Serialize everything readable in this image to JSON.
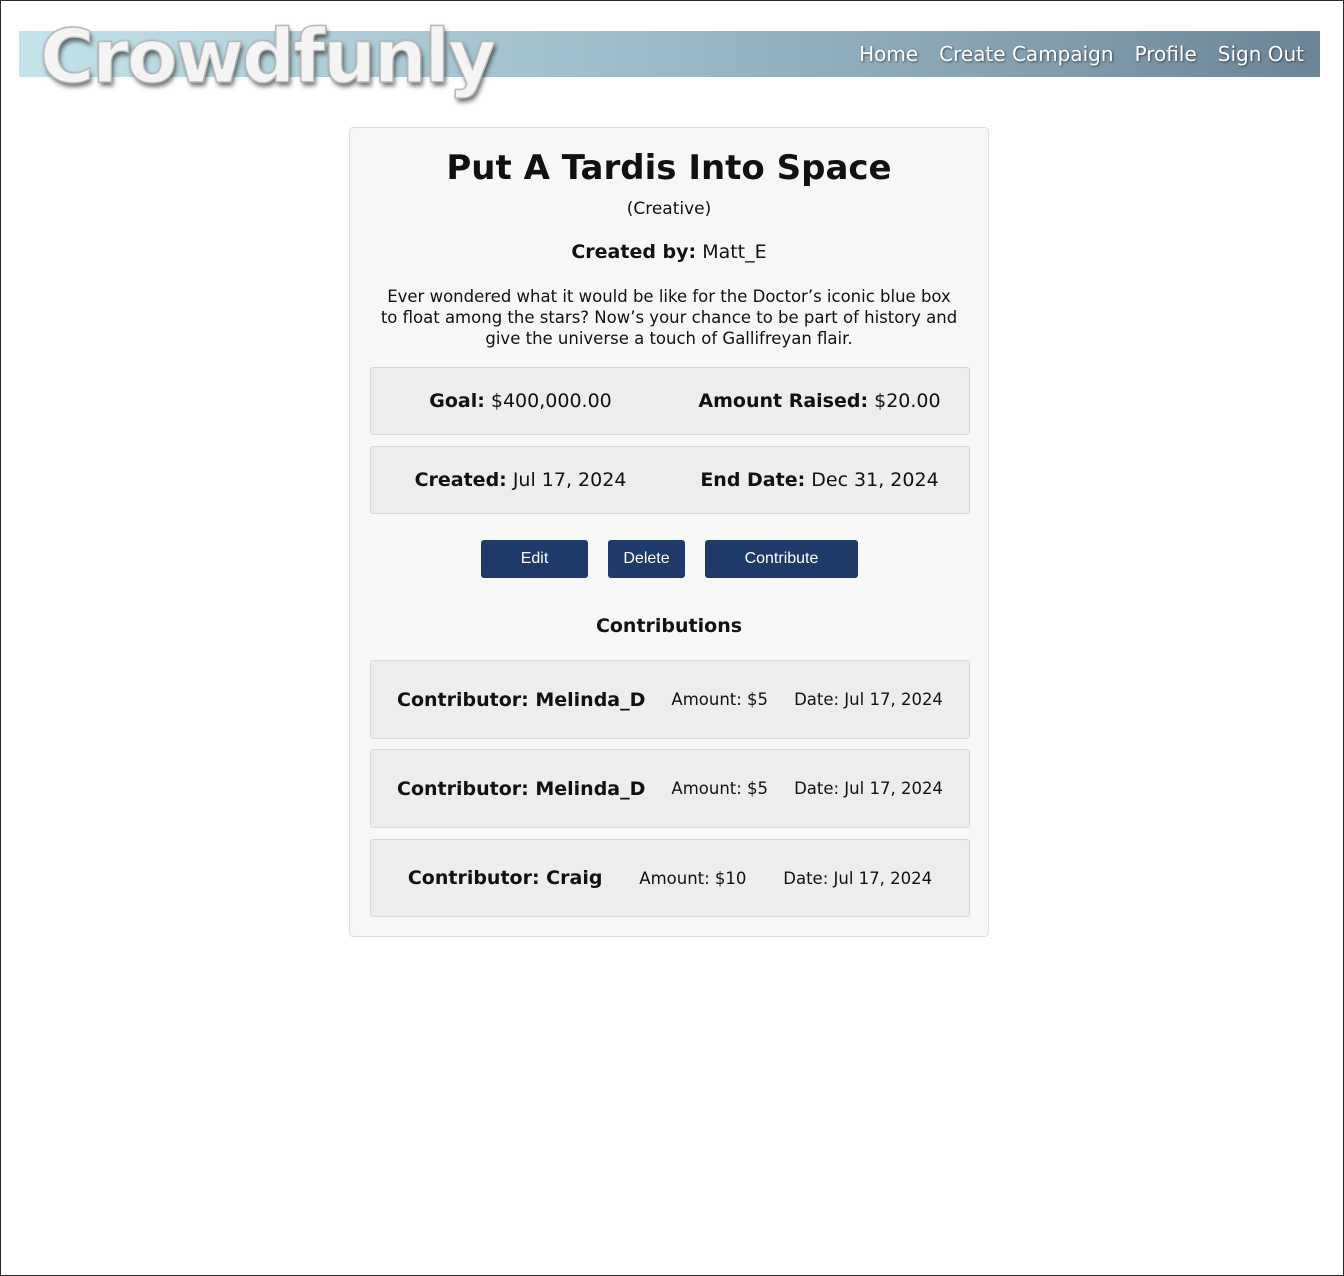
{
  "header": {
    "logo": "Crowdfunly",
    "nav": [
      "Home",
      "Create Campaign",
      "Profile",
      "Sign Out"
    ],
    "gradient_colors": [
      "#c3e3ea",
      "#6b8598"
    ]
  },
  "campaign": {
    "title": "Put A Tardis Into Space",
    "category": "(Creative)",
    "created_by_label": "Created by:",
    "creator": "Matt_E",
    "description": "Ever wondered what it would be like for the Doctor’s iconic blue box to float among the stars? Now’s your chance to be part of history and give the universe a touch of Gallifreyan flair.",
    "goal_label": "Goal:",
    "goal": "$400,000.00",
    "raised_label": "Amount Raised:",
    "raised": "$20.00",
    "created_label": "Created:",
    "created": "Jul 17, 2024",
    "end_label": "End Date:",
    "end": "Dec 31, 2024"
  },
  "actions": {
    "edit": "Edit",
    "delete": "Delete",
    "contribute": "Contribute",
    "button_color": "#1e3a68"
  },
  "contributions": {
    "heading": "Contributions",
    "rows": [
      {
        "contributor": "Contributor: Melinda_D",
        "amount": "Amount: $5",
        "date": "Date: Jul 17, 2024"
      },
      {
        "contributor": "Contributor: Melinda_D",
        "amount": "Amount: $5",
        "date": "Date: Jul 17, 2024"
      },
      {
        "contributor": "Contributor: Craig",
        "amount": "Amount: $10",
        "date": "Date: Jul 17, 2024"
      }
    ]
  }
}
